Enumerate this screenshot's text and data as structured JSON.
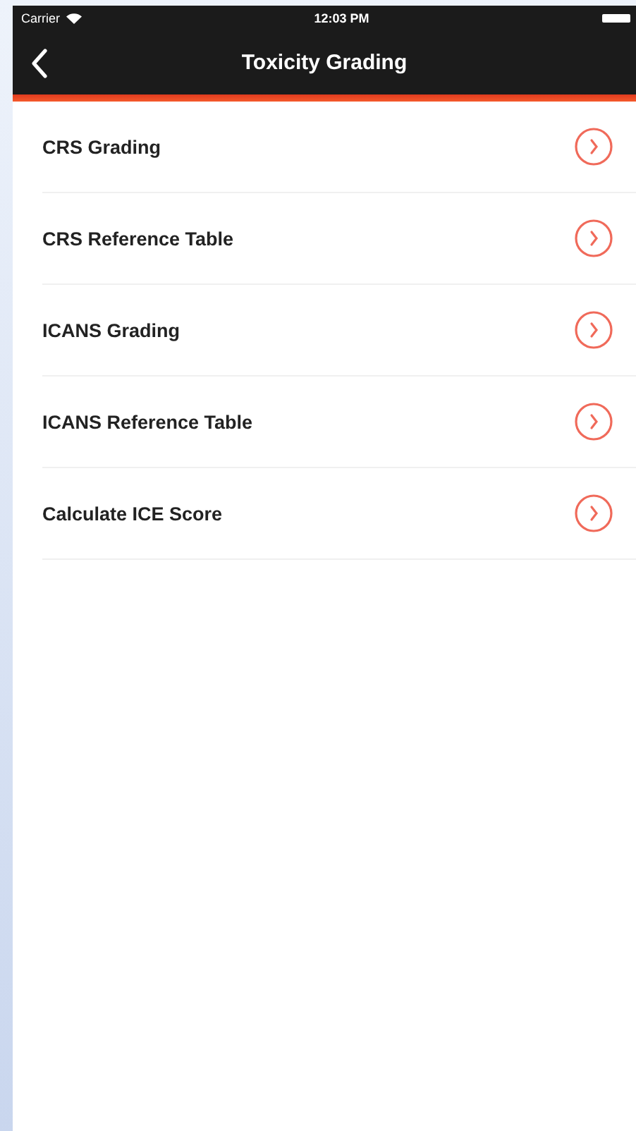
{
  "status_bar": {
    "carrier": "Carrier",
    "time": "12:03 PM"
  },
  "nav_bar": {
    "title": "Toxicity Grading"
  },
  "menu": [
    {
      "label": "CRS Grading"
    },
    {
      "label": "CRS Reference Table"
    },
    {
      "label": "ICANS Grading"
    },
    {
      "label": "ICANS Reference Table"
    },
    {
      "label": "Calculate ICE Score"
    }
  ]
}
